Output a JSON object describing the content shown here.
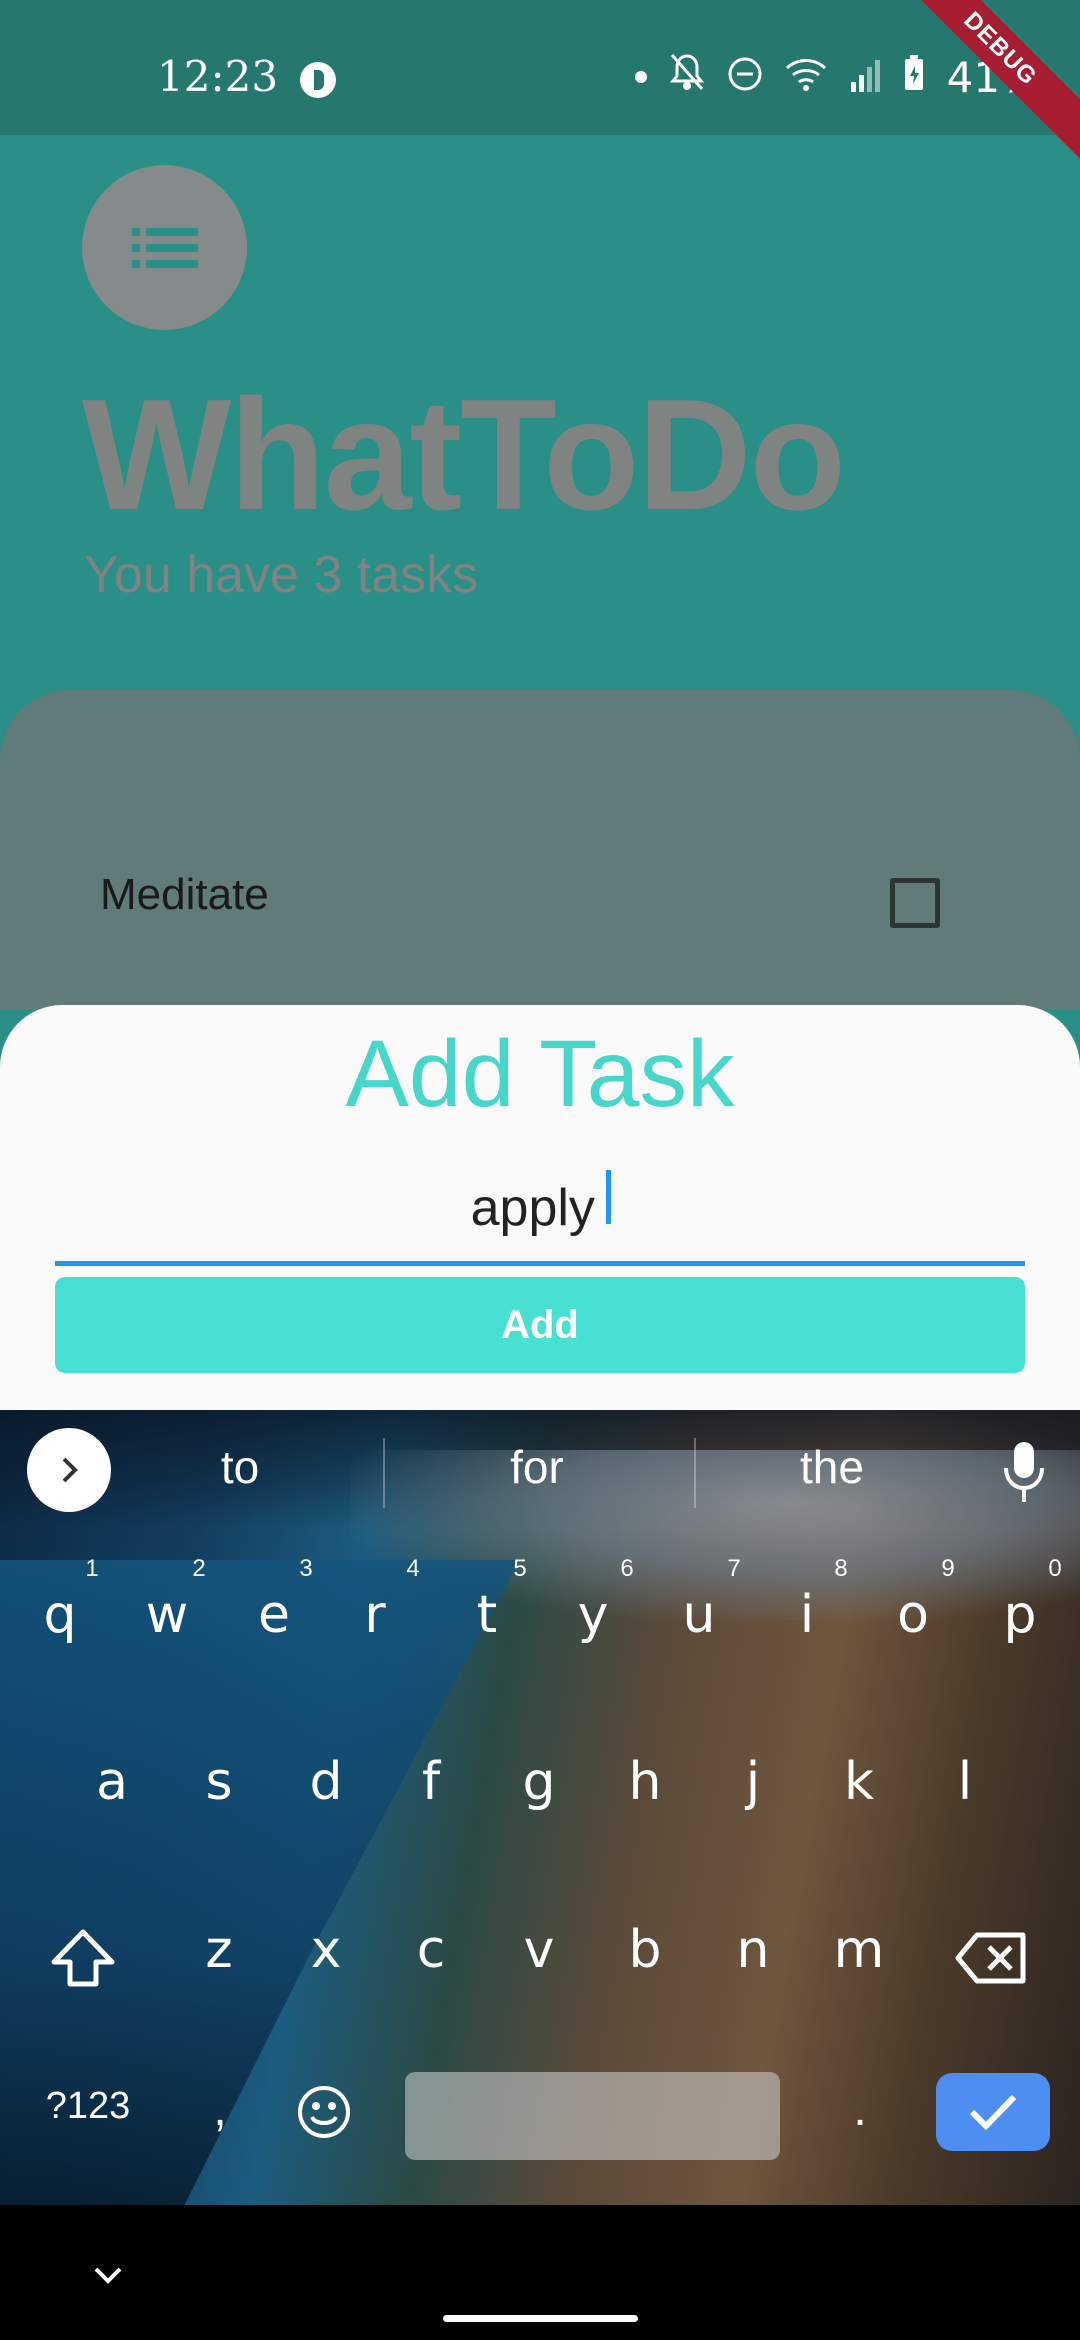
{
  "status_bar": {
    "time": "12:23",
    "battery": "41%",
    "debug_label": "DEBUG",
    "icons": [
      "app-icon",
      "dot-icon",
      "bell-off-icon",
      "dnd-icon",
      "wifi-icon",
      "signal-icon",
      "battery-icon"
    ]
  },
  "header": {
    "menu_icon": "list-icon",
    "title": "WhatToDo",
    "subtitle": "You have 3 tasks"
  },
  "tasks": [
    {
      "label": "Meditate",
      "checked": false
    }
  ],
  "sheet": {
    "title": "Add Task",
    "input_value": "apply ",
    "add_label": "Add"
  },
  "keyboard": {
    "suggestions": [
      "to",
      "for",
      "the"
    ],
    "row1": [
      "q",
      "w",
      "e",
      "r",
      "t",
      "y",
      "u",
      "i",
      "o",
      "p"
    ],
    "row1_nums": [
      "1",
      "2",
      "3",
      "4",
      "5",
      "6",
      "7",
      "8",
      "9",
      "0"
    ],
    "row2": [
      "a",
      "s",
      "d",
      "f",
      "g",
      "h",
      "j",
      "k",
      "l"
    ],
    "row3": [
      "z",
      "x",
      "c",
      "v",
      "b",
      "n",
      "m"
    ],
    "symbols_label": "?123",
    "comma": ",",
    "period": "."
  },
  "colors": {
    "accent": "#47d6c9",
    "input_underline": "#2196f3",
    "add_button": "#47e0d2",
    "done_key": "#4d8ef0"
  }
}
